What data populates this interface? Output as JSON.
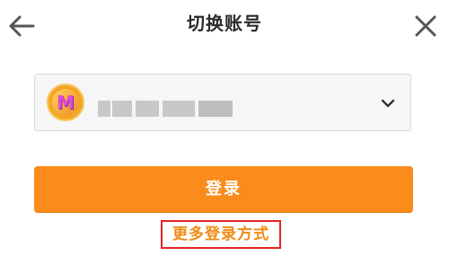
{
  "header": {
    "title": "切换账号",
    "back_icon": "arrow-left-icon",
    "close_icon": "close-icon"
  },
  "account_select": {
    "avatar_letter": "M",
    "username_masked": true,
    "dropdown_icon": "chevron-down-icon"
  },
  "login_button": {
    "label": "登录"
  },
  "more_login": {
    "label": "更多登录方式"
  },
  "colors": {
    "accent": "#fb8c1c",
    "link": "#f08a14",
    "highlight_border": "#e22424"
  }
}
